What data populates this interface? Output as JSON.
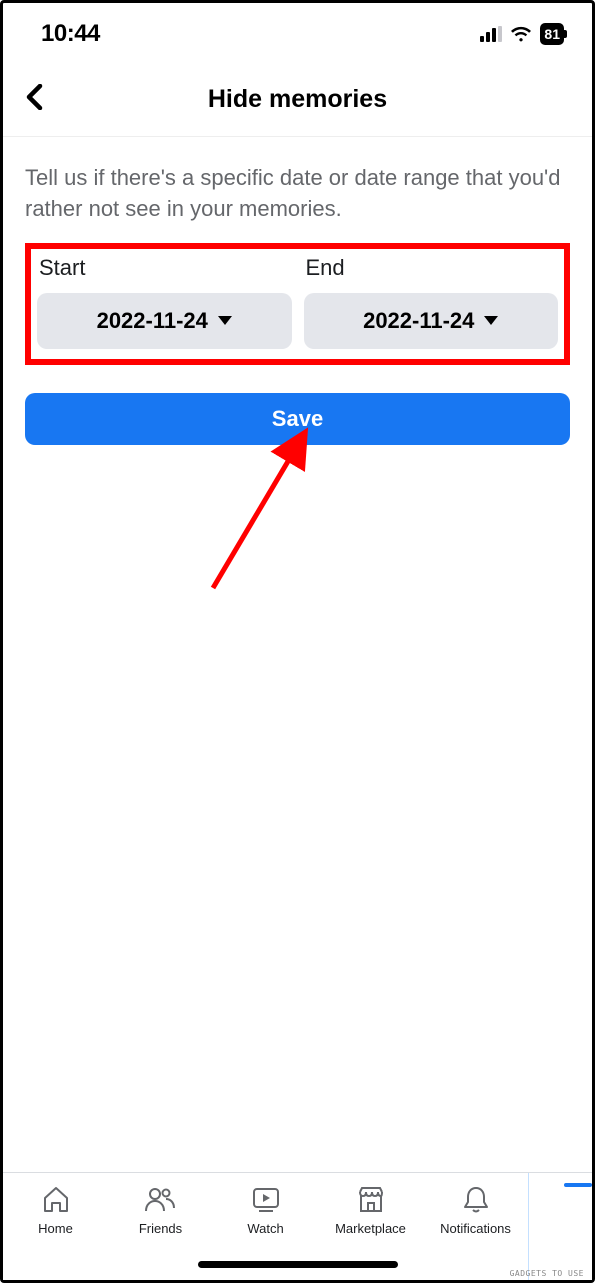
{
  "status": {
    "time": "10:44",
    "battery": "81"
  },
  "header": {
    "title": "Hide memories"
  },
  "content": {
    "description": "Tell us if there's a specific date or date range that you'd rather not see in your memories."
  },
  "form": {
    "start_label": "Start",
    "end_label": "End",
    "start_value": "2022-11-24",
    "end_value": "2022-11-24",
    "save_label": "Save"
  },
  "tabs": {
    "home": "Home",
    "friends": "Friends",
    "watch": "Watch",
    "marketplace": "Marketplace",
    "notifications": "Notifications"
  },
  "watermark": "GADGETS TO USE"
}
